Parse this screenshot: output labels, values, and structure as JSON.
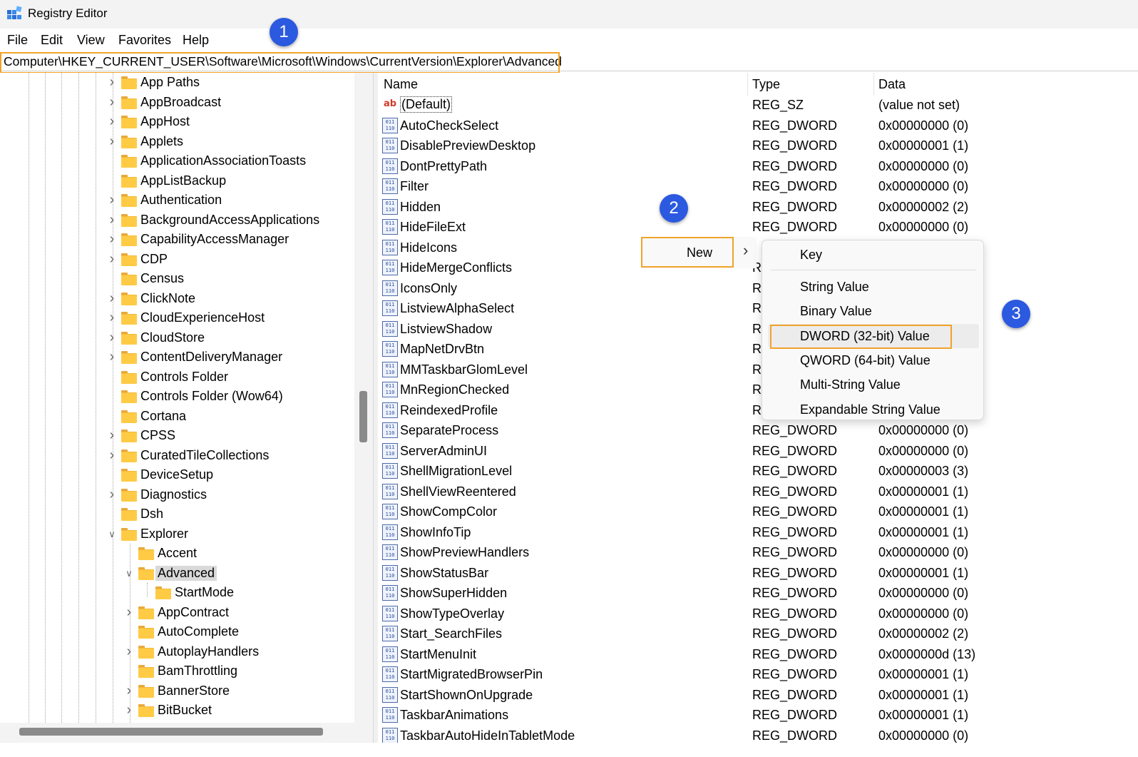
{
  "window": {
    "title": "Registry Editor"
  },
  "menu": [
    "File",
    "Edit",
    "View",
    "Favorites",
    "Help"
  ],
  "address": {
    "path": "Computer\\HKEY_CURRENT_USER\\Software\\Microsoft\\Windows\\CurrentVersion\\Explorer\\Advanced"
  },
  "badges": [
    "1",
    "2",
    "3"
  ],
  "tree": {
    "items": [
      {
        "label": "App Paths",
        "level": 0,
        "expander": ">"
      },
      {
        "label": "AppBroadcast",
        "level": 0,
        "expander": ">"
      },
      {
        "label": "AppHost",
        "level": 0,
        "expander": ">"
      },
      {
        "label": "Applets",
        "level": 0,
        "expander": ">"
      },
      {
        "label": "ApplicationAssociationToasts",
        "level": 0,
        "expander": ""
      },
      {
        "label": "AppListBackup",
        "level": 0,
        "expander": ""
      },
      {
        "label": "Authentication",
        "level": 0,
        "expander": ">"
      },
      {
        "label": "BackgroundAccessApplications",
        "level": 0,
        "expander": ">"
      },
      {
        "label": "CapabilityAccessManager",
        "level": 0,
        "expander": ">"
      },
      {
        "label": "CDP",
        "level": 0,
        "expander": ">"
      },
      {
        "label": "Census",
        "level": 0,
        "expander": ""
      },
      {
        "label": "ClickNote",
        "level": 0,
        "expander": ">"
      },
      {
        "label": "CloudExperienceHost",
        "level": 0,
        "expander": ">"
      },
      {
        "label": "CloudStore",
        "level": 0,
        "expander": ">"
      },
      {
        "label": "ContentDeliveryManager",
        "level": 0,
        "expander": ">"
      },
      {
        "label": "Controls Folder",
        "level": 0,
        "expander": ""
      },
      {
        "label": "Controls Folder (Wow64)",
        "level": 0,
        "expander": ""
      },
      {
        "label": "Cortana",
        "level": 0,
        "expander": ""
      },
      {
        "label": "CPSS",
        "level": 0,
        "expander": ">"
      },
      {
        "label": "CuratedTileCollections",
        "level": 0,
        "expander": ">"
      },
      {
        "label": "DeviceSetup",
        "level": 0,
        "expander": ""
      },
      {
        "label": "Diagnostics",
        "level": 0,
        "expander": ">"
      },
      {
        "label": "Dsh",
        "level": 0,
        "expander": ""
      },
      {
        "label": "Explorer",
        "level": 0,
        "expander": "v"
      },
      {
        "label": "Accent",
        "level": 1,
        "expander": ""
      },
      {
        "label": "Advanced",
        "level": 1,
        "expander": "v",
        "selected": true
      },
      {
        "label": "StartMode",
        "level": 2,
        "expander": ""
      },
      {
        "label": "AppContract",
        "level": 1,
        "expander": ">"
      },
      {
        "label": "AutoComplete",
        "level": 1,
        "expander": ""
      },
      {
        "label": "AutoplayHandlers",
        "level": 1,
        "expander": ">"
      },
      {
        "label": "BamThrottling",
        "level": 1,
        "expander": ""
      },
      {
        "label": "BannerStore",
        "level": 1,
        "expander": ">"
      },
      {
        "label": "BitBucket",
        "level": 1,
        "expander": ">"
      }
    ]
  },
  "columns": {
    "name": "Name",
    "type": "Type",
    "data": "Data"
  },
  "values": [
    {
      "name": "(Default)",
      "type": "REG_SZ",
      "data": "(value not set)",
      "icon": "string-value-icon"
    },
    {
      "name": "AutoCheckSelect",
      "type": "REG_DWORD",
      "data": "0x00000000 (0)",
      "icon": "dword-value-icon"
    },
    {
      "name": "DisablePreviewDesktop",
      "type": "REG_DWORD",
      "data": "0x00000001 (1)",
      "icon": "dword-value-icon"
    },
    {
      "name": "DontPrettyPath",
      "type": "REG_DWORD",
      "data": "0x00000000 (0)",
      "icon": "dword-value-icon"
    },
    {
      "name": "Filter",
      "type": "REG_DWORD",
      "data": "0x00000000 (0)",
      "icon": "dword-value-icon"
    },
    {
      "name": "Hidden",
      "type": "REG_DWORD",
      "data": "0x00000002 (2)",
      "icon": "dword-value-icon"
    },
    {
      "name": "HideFileExt",
      "type": "REG_DWORD",
      "data": "0x00000000 (0)",
      "icon": "dword-value-icon"
    },
    {
      "name": "HideIcons",
      "type": "",
      "data": "",
      "icon": "dword-value-icon"
    },
    {
      "name": "HideMergeConflicts",
      "type": "R",
      "data": "",
      "icon": "dword-value-icon"
    },
    {
      "name": "IconsOnly",
      "type": "R",
      "data": "",
      "icon": "dword-value-icon"
    },
    {
      "name": "ListviewAlphaSelect",
      "type": "R",
      "data": "",
      "icon": "dword-value-icon"
    },
    {
      "name": "ListviewShadow",
      "type": "R",
      "data": "",
      "icon": "dword-value-icon"
    },
    {
      "name": "MapNetDrvBtn",
      "type": "R",
      "data": "",
      "icon": "dword-value-icon"
    },
    {
      "name": "MMTaskbarGlomLevel",
      "type": "R",
      "data": "",
      "icon": "dword-value-icon"
    },
    {
      "name": "MnRegionChecked",
      "type": "R",
      "data": "",
      "icon": "dword-value-icon"
    },
    {
      "name": "ReindexedProfile",
      "type": "R",
      "data": "",
      "icon": "dword-value-icon"
    },
    {
      "name": "SeparateProcess",
      "type": "REG_DWORD",
      "data": "0x00000000 (0)",
      "icon": "dword-value-icon"
    },
    {
      "name": "ServerAdminUI",
      "type": "REG_DWORD",
      "data": "0x00000000 (0)",
      "icon": "dword-value-icon"
    },
    {
      "name": "ShellMigrationLevel",
      "type": "REG_DWORD",
      "data": "0x00000003 (3)",
      "icon": "dword-value-icon"
    },
    {
      "name": "ShellViewReentered",
      "type": "REG_DWORD",
      "data": "0x00000001 (1)",
      "icon": "dword-value-icon"
    },
    {
      "name": "ShowCompColor",
      "type": "REG_DWORD",
      "data": "0x00000001 (1)",
      "icon": "dword-value-icon"
    },
    {
      "name": "ShowInfoTip",
      "type": "REG_DWORD",
      "data": "0x00000001 (1)",
      "icon": "dword-value-icon"
    },
    {
      "name": "ShowPreviewHandlers",
      "type": "REG_DWORD",
      "data": "0x00000000 (0)",
      "icon": "dword-value-icon"
    },
    {
      "name": "ShowStatusBar",
      "type": "REG_DWORD",
      "data": "0x00000001 (1)",
      "icon": "dword-value-icon"
    },
    {
      "name": "ShowSuperHidden",
      "type": "REG_DWORD",
      "data": "0x00000000 (0)",
      "icon": "dword-value-icon"
    },
    {
      "name": "ShowTypeOverlay",
      "type": "REG_DWORD",
      "data": "0x00000000 (0)",
      "icon": "dword-value-icon"
    },
    {
      "name": "Start_SearchFiles",
      "type": "REG_DWORD",
      "data": "0x00000002 (2)",
      "icon": "dword-value-icon"
    },
    {
      "name": "StartMenuInit",
      "type": "REG_DWORD",
      "data": "0x0000000d (13)",
      "icon": "dword-value-icon"
    },
    {
      "name": "StartMigratedBrowserPin",
      "type": "REG_DWORD",
      "data": "0x00000001 (1)",
      "icon": "dword-value-icon"
    },
    {
      "name": "StartShownOnUpgrade",
      "type": "REG_DWORD",
      "data": "0x00000001 (1)",
      "icon": "dword-value-icon"
    },
    {
      "name": "TaskbarAnimations",
      "type": "REG_DWORD",
      "data": "0x00000001 (1)",
      "icon": "dword-value-icon"
    },
    {
      "name": "TaskbarAutoHideInTabletMode",
      "type": "REG_DWORD",
      "data": "0x00000000 (0)",
      "icon": "dword-value-icon"
    }
  ],
  "context_menu": {
    "new_label": "New",
    "arrow": ">",
    "submenu": [
      "Key",
      "String Value",
      "Binary Value",
      "DWORD (32-bit) Value",
      "QWORD (64-bit) Value",
      "Multi-String Value",
      "Expandable String Value"
    ],
    "hovered_item": "DWORD (32-bit) Value"
  },
  "colors": {
    "highlight": "#f0a32b",
    "badge": "#2b59e0",
    "folder": "#ffcb45"
  }
}
